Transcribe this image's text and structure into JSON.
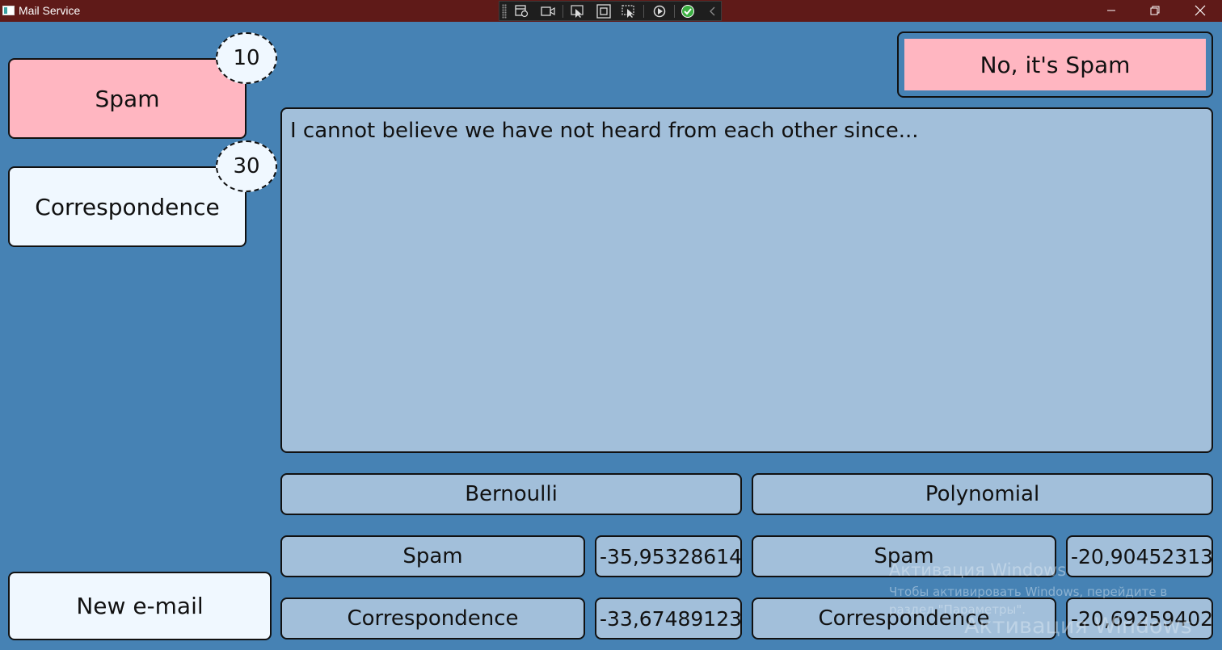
{
  "window": {
    "title": "Mail Service",
    "controls": {
      "minimize": "minimize-icon",
      "restore": "restore-icon",
      "close": "close-icon"
    }
  },
  "debug_toolbar": {
    "buttons": [
      "live-visual-tree-icon",
      "record-icon",
      "select-element-icon",
      "display-layout-adorners-icon",
      "track-focus-icon",
      "hot-reload-icon",
      "check-icon",
      "collapse-icon"
    ]
  },
  "folders": [
    {
      "label": "Spam",
      "count": "10",
      "color": "#FFB6C1"
    },
    {
      "label": "Correspondence",
      "count": "30",
      "color": "#F0F8FF"
    }
  ],
  "new_email_label": "New e-mail",
  "verdict_label": "No, it's Spam",
  "email_text": "I cannot believe we have not heard from each other since...",
  "classifiers": [
    {
      "name": "Bernoulli",
      "results": [
        {
          "label": "Spam",
          "score": "-35,95328614"
        },
        {
          "label": "Correspondence",
          "score": "-33,67489123"
        }
      ]
    },
    {
      "name": "Polynomial",
      "results": [
        {
          "label": "Spam",
          "score": "-20,90452313"
        },
        {
          "label": "Correspondence",
          "score": "-20,69259402"
        }
      ]
    }
  ],
  "watermark": {
    "title": "Активация Windows",
    "line1": "Чтобы активировать Windows, перейдите в",
    "line2": "раздел \"Параметры\"."
  },
  "colors": {
    "background": "#4682B4",
    "titlebar": "#5F1A18",
    "spam": "#FFB6C1",
    "light": "#F0F8FF",
    "panel": "#A2BFDA"
  }
}
